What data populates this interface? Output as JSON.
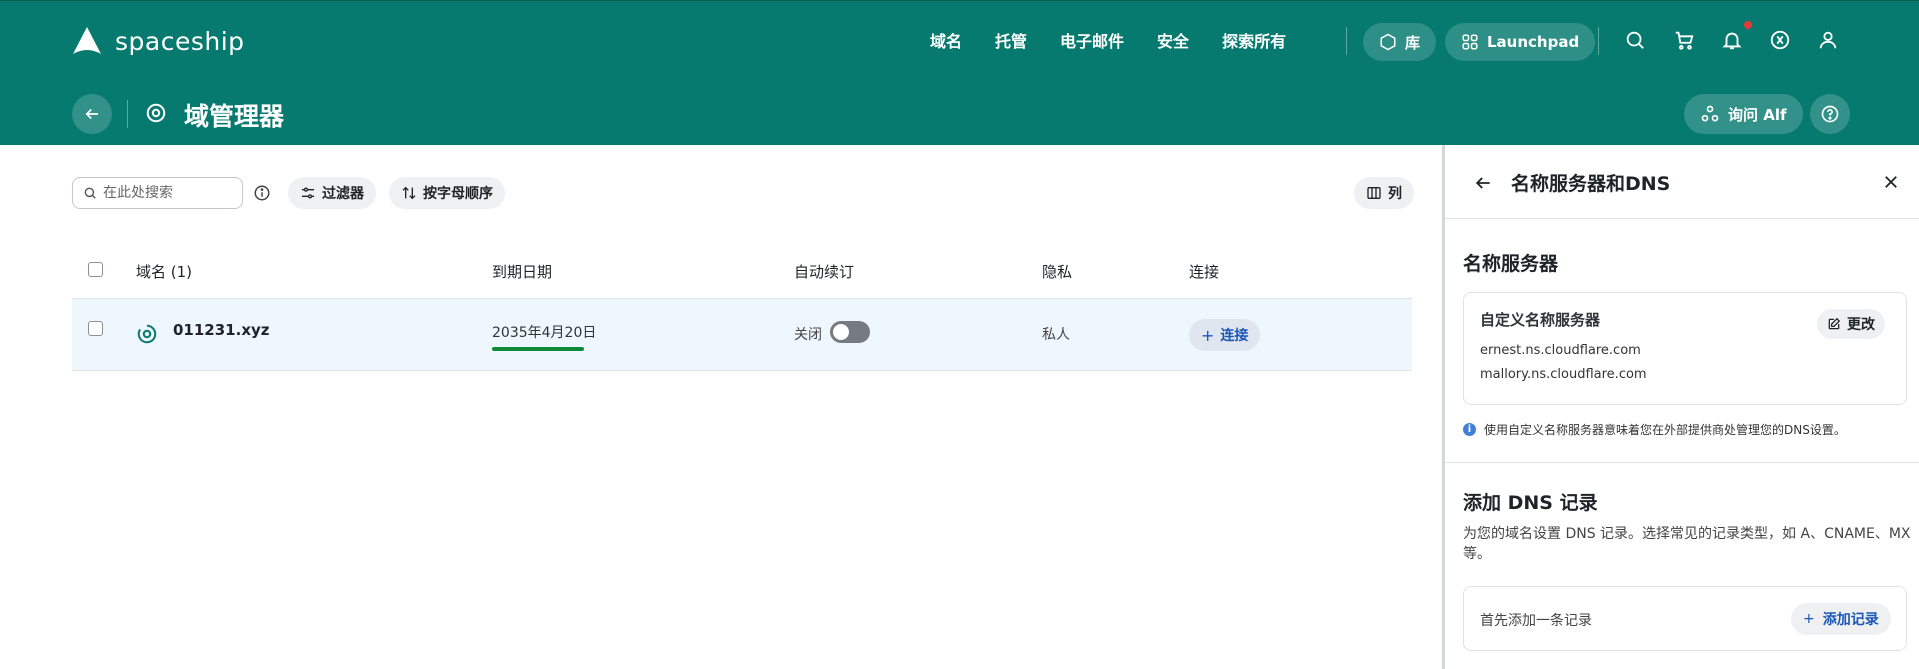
{
  "brand": {
    "name": "spaceship",
    "color_primary": "#067a6f",
    "accent_link": "#1a56b8"
  },
  "nav": {
    "items": [
      "域名",
      "托管",
      "电子邮件",
      "安全",
      "探索所有"
    ],
    "library_label": "库",
    "launchpad_label": "Launchpad",
    "icons": [
      "search-icon",
      "cart-icon",
      "bell-icon",
      "support-icon",
      "user-icon"
    ]
  },
  "subbar": {
    "title": "域管理器",
    "ask_label": "询问 Alf"
  },
  "toolbar": {
    "search_placeholder": "在此处搜索",
    "filter_label": "过滤器",
    "sort_label": "按字母顺序",
    "columns_label": "列"
  },
  "table": {
    "headers": {
      "domain": "域名 (1)",
      "expiry": "到期日期",
      "autorenew": "自动续订",
      "privacy": "隐私",
      "connect": "连接"
    },
    "rows": [
      {
        "domain": "011231.xyz",
        "expiry": "2035年4月20日",
        "autorenew_label": "关闭",
        "autorenew_on": false,
        "privacy": "私人",
        "connect_label": "连接"
      }
    ]
  },
  "panel": {
    "title": "名称服务器和DNS",
    "ns_section_title": "名称服务器",
    "ns_card_title": "自定义名称服务器",
    "ns_edit_label": "更改",
    "nameservers": [
      "ernest.ns.cloudflare.com",
      "mallory.ns.cloudflare.com"
    ],
    "ns_note": "使用自定义名称服务器意味着您在外部提供商处管理您的DNS设置。",
    "dns_section_title": "添加 DNS 记录",
    "dns_desc": "为您的域名设置 DNS 记录。选择常见的记录类型，如 A、CNAME、MX 等。",
    "dns_empty_text": "首先添加一条记录",
    "add_record_label": "添加记录"
  }
}
